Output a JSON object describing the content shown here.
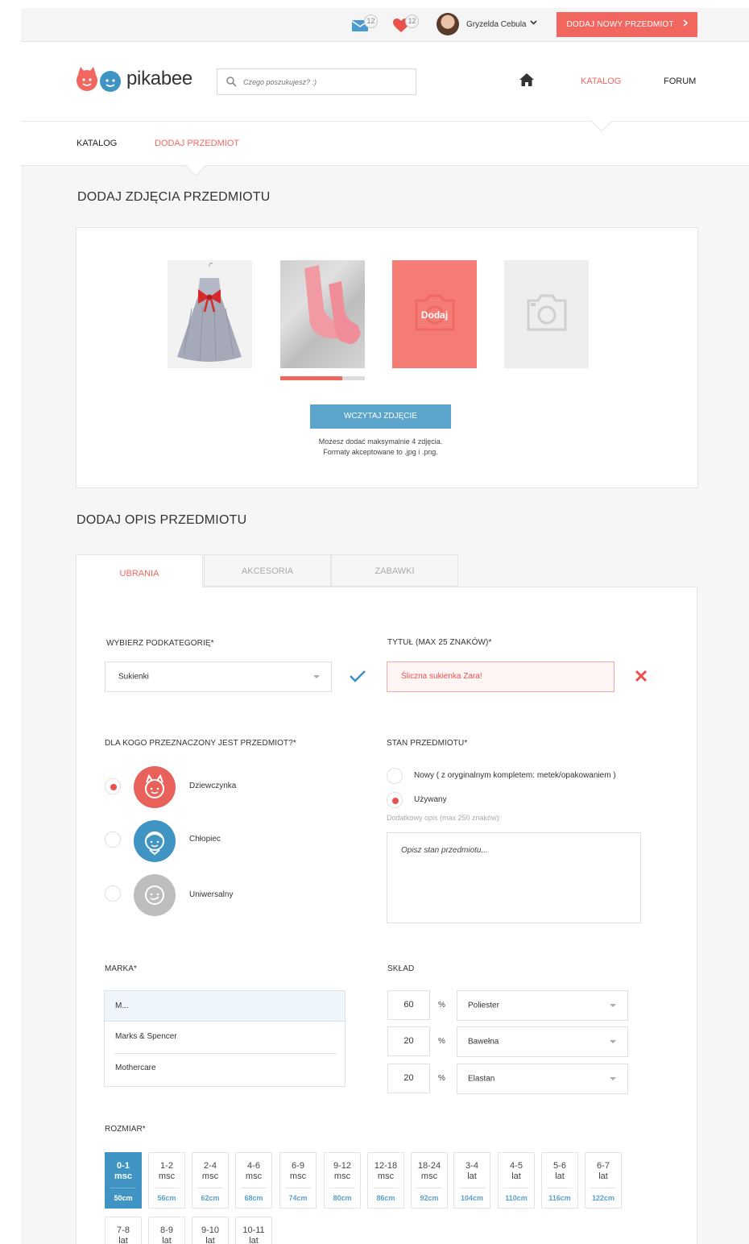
{
  "topbar": {
    "messages_count": "12",
    "favorites_count": "12",
    "username": "Gryzelda Cebula",
    "add_button": "DODAJ NOWY PRZEDMIOT"
  },
  "header": {
    "logo": "pikabee",
    "search_placeholder": "Czego poszukujesz? :)",
    "nav": {
      "catalog": "KATALOG",
      "forum": "FORUM"
    }
  },
  "breadcrumb": {
    "catalog": "KATALOG",
    "add_item": "DODAJ PRZEDMIOT"
  },
  "photos": {
    "title": "DODAJ ZDJĘCIA PRZEDMIOTU",
    "add_label": "Dodaj",
    "upload_progress": 0.73,
    "upload_button": "WCZYTAJ ZDJĘCIE",
    "note_line1": "Możesz dodać maksymalnie 4 zdjęcia.",
    "note_line2": "Formaty akceptowane to .jpg i .png."
  },
  "description": {
    "title": "DODAJ OPIS PRZEDMIOTU",
    "tabs": [
      "UBRANIA",
      "AKCESORIA",
      "ZABAWKI"
    ],
    "subcategory_label": "WYBIERZ PODKATEGORIĘ*",
    "subcategory_value": "Sukienki",
    "title_label": "TYTUŁ (MAX 25 ZNAKÓW)*",
    "title_value": "Śliczna sukienka Zara!",
    "for_whom_label": "DLA KOGO PRZEZNACZONY JEST PRZEDMIOT?*",
    "genders": [
      "Dziewczynka",
      "Chłopiec",
      "Uniwersalny"
    ],
    "condition_label": "STAN PRZEDMIOTU*",
    "condition_new": "Nowy ( z oryginalnym kompletem: metek/opakowaniem )",
    "condition_used": "Używany",
    "extra_label": "Dodatkowy opis (max 250 znaków):",
    "extra_placeholder": "Opisz stan przedmiotu...",
    "brand_label": "MARKA*",
    "brand_input": "M...",
    "brand_options": [
      "Marks & Spencer",
      "Mothercare"
    ],
    "composition_label": "SKŁAD",
    "composition": [
      {
        "pct": "60",
        "material": "Poliester"
      },
      {
        "pct": "20",
        "material": "Bawełna"
      },
      {
        "pct": "20",
        "material": "Elastan"
      }
    ],
    "percent_sign": "%",
    "size_label": "ROZMIAR*",
    "sizes": [
      {
        "top": "0-1",
        "unit": "msc",
        "cm": "50cm"
      },
      {
        "top": "1-2",
        "unit": "msc",
        "cm": "56cm"
      },
      {
        "top": "2-4",
        "unit": "msc",
        "cm": "62cm"
      },
      {
        "top": "4-6",
        "unit": "msc",
        "cm": "68cm"
      },
      {
        "top": "6-9",
        "unit": "msc",
        "cm": "74cm"
      },
      {
        "top": "9-12",
        "unit": "msc",
        "cm": "80cm"
      },
      {
        "top": "12-18",
        "unit": "msc",
        "cm": "86cm"
      },
      {
        "top": "18-24",
        "unit": "msc",
        "cm": "92cm"
      },
      {
        "top": "3-4",
        "unit": "lat",
        "cm": "104cm"
      },
      {
        "top": "4-5",
        "unit": "lat",
        "cm": "110cm"
      },
      {
        "top": "5-6",
        "unit": "lat",
        "cm": "116cm"
      },
      {
        "top": "6-7",
        "unit": "lat",
        "cm": "122cm"
      },
      {
        "top": "7-8",
        "unit": "lat",
        "cm": ""
      },
      {
        "top": "8-9",
        "unit": "lat",
        "cm": ""
      },
      {
        "top": "9-10",
        "unit": "lat",
        "cm": ""
      },
      {
        "top": "10-11",
        "unit": "lat",
        "cm": ""
      }
    ]
  },
  "colors": {
    "accent": "#f26660",
    "blue": "#3f94c4",
    "upload_blue": "#5ba4cc"
  }
}
